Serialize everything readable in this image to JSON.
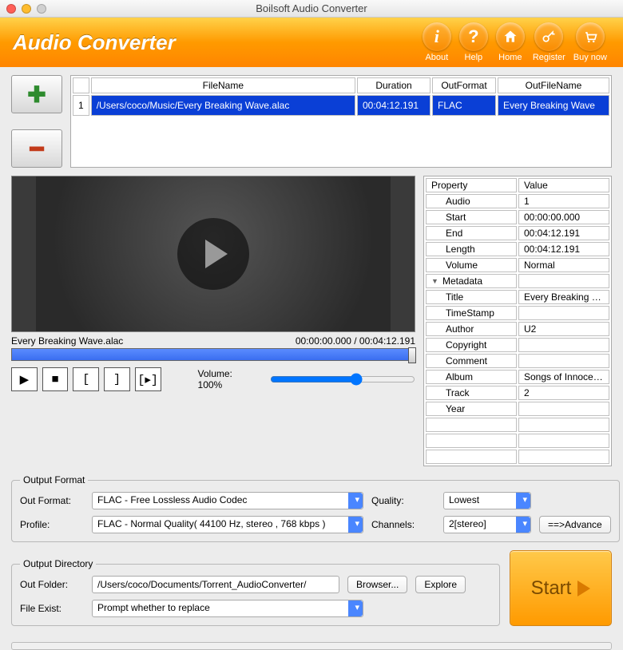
{
  "window": {
    "title": "Boilsoft Audio Converter"
  },
  "header": {
    "app_title": "Audio Converter",
    "buttons": {
      "about": "About",
      "help": "Help",
      "home": "Home",
      "register": "Register",
      "buynow": "Buy now"
    }
  },
  "file_table": {
    "columns": {
      "filename": "FileName",
      "duration": "Duration",
      "outformat": "OutFormat",
      "outfilename": "OutFileName"
    },
    "rows": [
      {
        "index": "1",
        "filename": "/Users/coco/Music/Every Breaking Wave.alac",
        "duration": "00:04:12.191",
        "outformat": "FLAC",
        "outfilename": "Every Breaking Wave"
      }
    ]
  },
  "preview": {
    "current_file": "Every Breaking Wave.alac",
    "time_display": "00:00:00.000 / 00:04:12.191",
    "volume_label": "Volume: 100%"
  },
  "properties": {
    "header_prop": "Property",
    "header_val": "Value",
    "audio": {
      "group": "Audio",
      "value": "1",
      "start": {
        "label": "Start",
        "value": "00:00:00.000"
      },
      "end": {
        "label": "End",
        "value": "00:04:12.191"
      },
      "length": {
        "label": "Length",
        "value": "00:04:12.191"
      },
      "volume": {
        "label": "Volume",
        "value": "Normal"
      }
    },
    "metadata": {
      "group": "Metadata",
      "title": {
        "label": "Title",
        "value": "Every Breaking …"
      },
      "timestamp": {
        "label": "TimeStamp",
        "value": ""
      },
      "author": {
        "label": "Author",
        "value": "U2"
      },
      "copyright": {
        "label": "Copyright",
        "value": ""
      },
      "comment": {
        "label": "Comment",
        "value": ""
      },
      "album": {
        "label": "Album",
        "value": "Songs of Innoce…"
      },
      "track": {
        "label": "Track",
        "value": "2"
      },
      "year": {
        "label": "Year",
        "value": ""
      }
    }
  },
  "output_format": {
    "legend": "Output Format",
    "out_format_label": "Out Format:",
    "out_format_value": "FLAC - Free Lossless Audio Codec",
    "profile_label": "Profile:",
    "profile_value": "FLAC - Normal Quality( 44100 Hz, stereo , 768 kbps )",
    "quality_label": "Quality:",
    "quality_value": "Lowest",
    "channels_label": "Channels:",
    "channels_value": "2[stereo]",
    "advance_label": "==>Advance"
  },
  "output_directory": {
    "legend": "Output Directory",
    "out_folder_label": "Out Folder:",
    "out_folder_value": "/Users/coco/Documents/Torrent_AudioConverter/",
    "browser_label": "Browser...",
    "explore_label": "Explore",
    "file_exist_label": "File Exist:",
    "file_exist_value": "Prompt whether to replace"
  },
  "start_label": "Start"
}
